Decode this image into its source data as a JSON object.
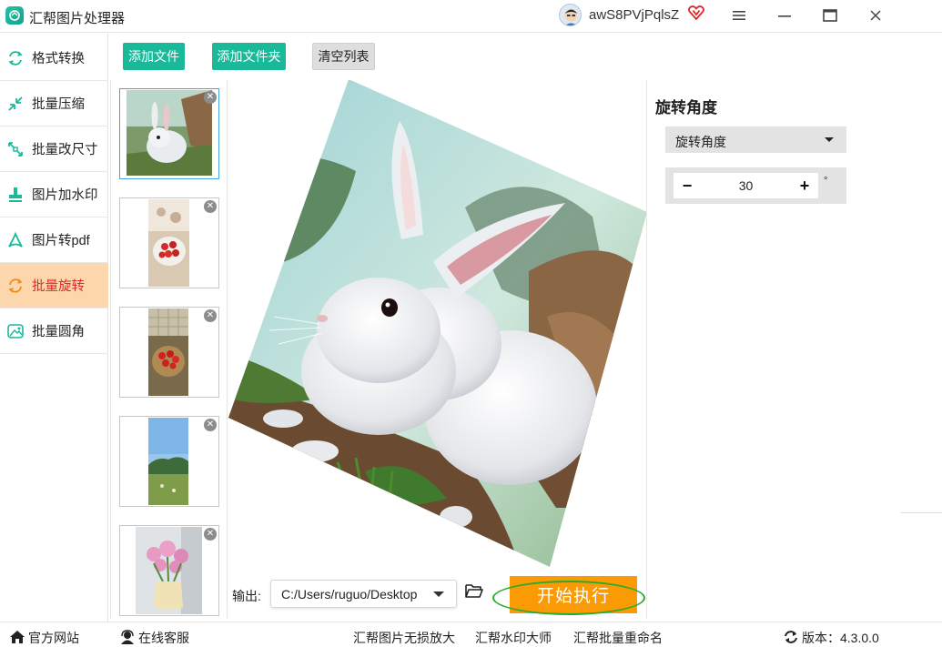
{
  "titlebar": {
    "app_title": "汇帮图片处理器",
    "user_name": "awS8PVjPqlsZ",
    "icons": [
      "app-logo-icon",
      "user-avatar",
      "vip-heart-icon",
      "menu-icon",
      "minimize-icon",
      "maximize-icon",
      "close-icon"
    ]
  },
  "sidebar": {
    "items": [
      {
        "label": "格式转换",
        "icon": "format-convert-icon"
      },
      {
        "label": "批量压缩",
        "icon": "compress-icon"
      },
      {
        "label": "批量改尺寸",
        "icon": "resize-icon"
      },
      {
        "label": "图片加水印",
        "icon": "watermark-icon"
      },
      {
        "label": "图片转pdf",
        "icon": "pdf-icon"
      },
      {
        "label": "批量旋转",
        "icon": "rotate-icon",
        "active": true
      },
      {
        "label": "批量圆角",
        "icon": "round-corner-icon"
      }
    ]
  },
  "toolbar": {
    "add_file": "添加文件",
    "add_folder": "添加文件夹",
    "clear_list": "清空列表"
  },
  "thumbnails": [
    {
      "subject": "rabbit",
      "selected": true
    },
    {
      "subject": "strawberry-plate"
    },
    {
      "subject": "strawberry-basket"
    },
    {
      "subject": "landscape"
    },
    {
      "subject": "tulips-vase"
    }
  ],
  "preview": {
    "rotation_deg": 30
  },
  "output": {
    "label": "输出:",
    "path": "C:/Users/ruguo/Desktop"
  },
  "start_button": "开始执行",
  "settings": {
    "title": "旋转角度",
    "mode": "旋转角度",
    "value": "30",
    "unit": "°"
  },
  "footer": {
    "official_site": "官方网站",
    "online_service": "在线客服",
    "link1": "汇帮图片无损放大",
    "link2": "汇帮水印大师",
    "link3": "汇帮批量重命名",
    "version": "版本：4.3.0.0"
  },
  "colors": {
    "accent_green": "#19b99a",
    "active_bg": "#fbd7ab",
    "active_text": "#e3262a",
    "start_orange": "#fa9a05",
    "ring_green": "#2bab2b"
  }
}
